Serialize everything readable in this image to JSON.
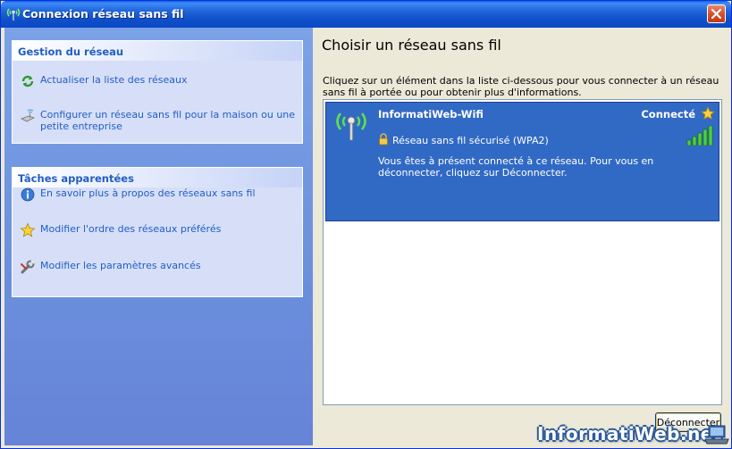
{
  "window": {
    "title": "Connexion réseau sans fil",
    "close_icon": "close-x-icon",
    "accent": "#0a5ee8"
  },
  "left": {
    "network_tasks": {
      "header": "Gestion du réseau",
      "items": [
        {
          "label": "Actualiser la liste des réseaux",
          "icon": "refresh-icon"
        },
        {
          "label": "Configurer un réseau sans fil pour la maison ou une petite entreprise",
          "icon": "wireless-setup-icon"
        }
      ]
    },
    "related_tasks": {
      "header": "Tâches apparentées",
      "items": [
        {
          "label": "En savoir plus à propos des réseaux sans fil",
          "icon": "info-icon"
        },
        {
          "label": "Modifier l'ordre des réseaux préférés",
          "icon": "star-icon"
        },
        {
          "label": "Modifier les paramètres avancés",
          "icon": "wrench-icon"
        }
      ]
    }
  },
  "main": {
    "title": "Choisir un réseau sans fil",
    "instructions": "Cliquez sur un élément dans la liste ci-dessous pour vous connecter à un réseau sans fil à portée ou pour obtenir plus d'informations.",
    "network": {
      "name": "InformatiWeb-Wifi",
      "status": "Connecté",
      "security": "Réseau sans fil sécurisé (WPA2)",
      "message": "Vous êtes à présent connecté à ce réseau. Pour vous en déconnecter, cliquez sur Déconnecter.",
      "signal_bars": 5,
      "signal_of": 5,
      "selected_color": "#316ac5"
    },
    "disconnect_label": "Déconnecter"
  },
  "watermark": "InformatiWeb.net"
}
